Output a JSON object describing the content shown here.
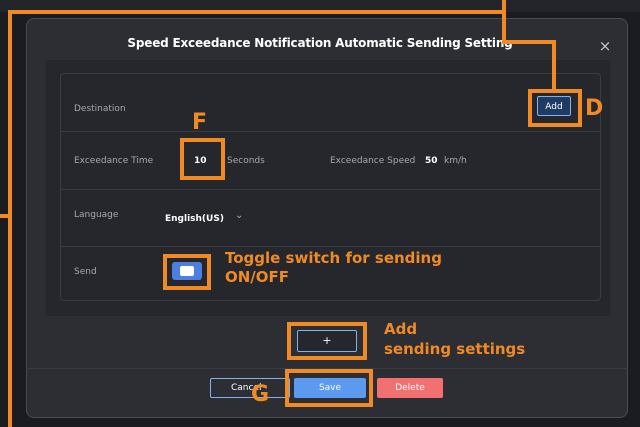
{
  "dialog": {
    "title": "Speed Exceedance Notification Automatic Sending Setting",
    "close_symbol": "×",
    "destination": {
      "label": "Destination",
      "add_button": "Add"
    },
    "exceedance_time": {
      "label": "Exceedance Time",
      "value": "10",
      "unit": "Seconds"
    },
    "exceedance_speed": {
      "label": "Exceedance Speed",
      "value": "50",
      "unit": "km/h"
    },
    "language": {
      "label": "Language",
      "selected": "English(US)"
    },
    "send": {
      "label": "Send",
      "state": "on"
    },
    "add_setting_button": "+",
    "footer": {
      "cancel": "Cancel",
      "save": "Save",
      "delete": "Delete"
    }
  },
  "annotations": {
    "D": "D",
    "F": "F",
    "G": "G",
    "toggle_line1": "Toggle switch for sending",
    "toggle_line2": "ON/OFF",
    "add_line1": "Add",
    "add_line2": "sending settings"
  },
  "colors": {
    "annotation": "#f08a24",
    "primary": "#5b9aef",
    "danger": "#f27070",
    "toggle_on": "#4c7fe0"
  },
  "icons": {
    "close": "close-icon",
    "dropdown": "chevron-down-icon",
    "toggle": "toggle-switch"
  }
}
